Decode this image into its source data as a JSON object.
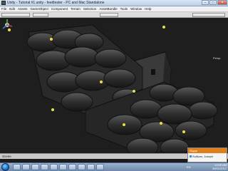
{
  "window": {
    "title": "Unity - Tutorial #1.unity - feedtester - PC and Mac Standalone"
  },
  "window_buttons": {
    "minimize": "–",
    "maximize": "□",
    "close": "×"
  },
  "menu": [
    "File",
    "Edit",
    "Assets",
    "GameObject",
    "Component",
    "Terrain",
    "Selection",
    "AssetBundle",
    "Tools",
    "Window",
    "Help"
  ],
  "scene": {
    "tab_label": "Scene",
    "view_mode": "Persp"
  },
  "notification": {
    "header": "Skype",
    "text": "Sullivan, Joseph"
  },
  "taskbar": {
    "items": [
      "ie-icon",
      "explorer-icon",
      "chrome-icon",
      "steam-icon",
      "media-icon",
      "word-icon",
      "unity-icon",
      "firefox-icon",
      "mono-icon",
      "paint-icon"
    ],
    "language": "EN",
    "time": "10:09 AM",
    "date": "30/01/2012"
  },
  "colors": {
    "viewport_bg": "#1e1e1e",
    "model": "#2b2b2b",
    "light_marker": "#e8e04a",
    "accent": "#e07e1a"
  }
}
